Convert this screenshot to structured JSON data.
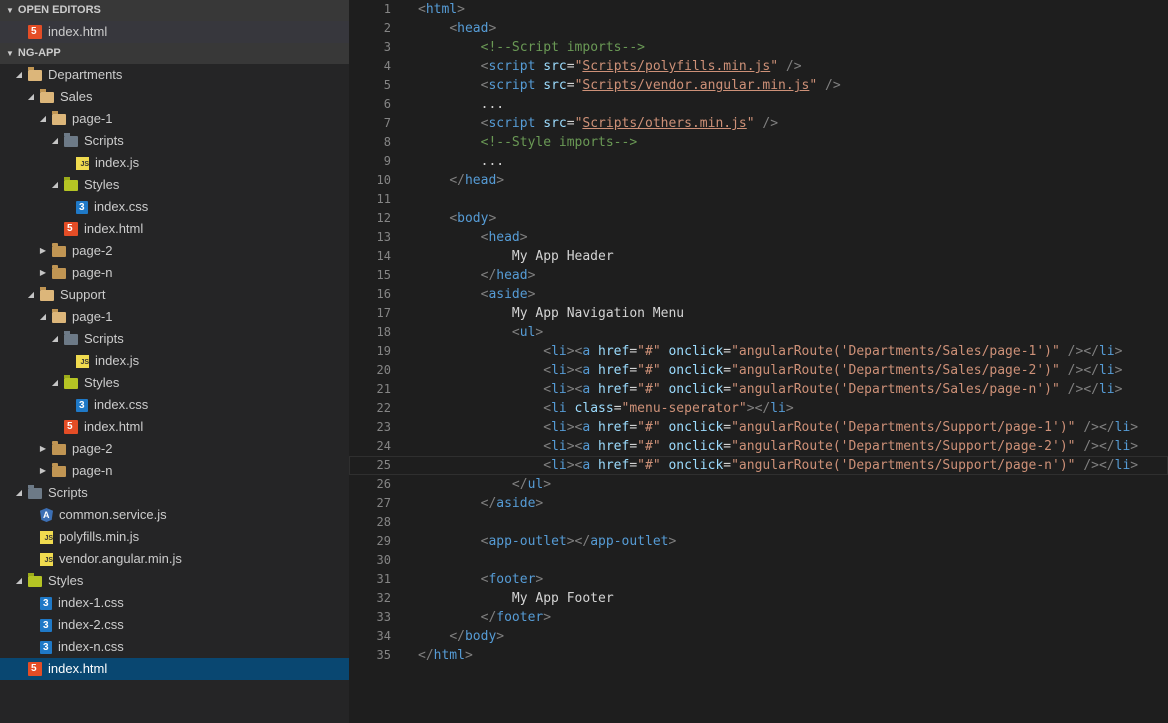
{
  "explorer": {
    "open_editors_title": "OPEN EDITORS",
    "open_editors": [
      {
        "label": "index.html",
        "icon": "html-file-icon"
      }
    ],
    "project_title": "NG-APP",
    "tree": [
      {
        "label": "Departments",
        "depth": 0,
        "expanded": true,
        "icon": "folder-open-icon"
      },
      {
        "label": "Sales",
        "depth": 1,
        "expanded": true,
        "icon": "folder-open-icon"
      },
      {
        "label": "page-1",
        "depth": 2,
        "expanded": true,
        "icon": "folder-open-icon"
      },
      {
        "label": "Scripts",
        "depth": 3,
        "expanded": true,
        "icon": "scripts-folder-icon"
      },
      {
        "label": "index.js",
        "depth": 4,
        "icon": "js-file-icon"
      },
      {
        "label": "Styles",
        "depth": 3,
        "expanded": true,
        "icon": "styles-folder-icon"
      },
      {
        "label": "index.css",
        "depth": 4,
        "icon": "css-file-icon"
      },
      {
        "label": "index.html",
        "depth": 3,
        "icon": "html-file-icon"
      },
      {
        "label": "page-2",
        "depth": 2,
        "expanded": false,
        "icon": "folder-icon"
      },
      {
        "label": "page-n",
        "depth": 2,
        "expanded": false,
        "icon": "folder-icon"
      },
      {
        "label": "Support",
        "depth": 1,
        "expanded": true,
        "icon": "folder-open-icon"
      },
      {
        "label": "page-1",
        "depth": 2,
        "expanded": true,
        "icon": "folder-open-icon"
      },
      {
        "label": "Scripts",
        "depth": 3,
        "expanded": true,
        "icon": "scripts-folder-icon"
      },
      {
        "label": "index.js",
        "depth": 4,
        "icon": "js-file-icon"
      },
      {
        "label": "Styles",
        "depth": 3,
        "expanded": true,
        "icon": "styles-folder-icon"
      },
      {
        "label": "index.css",
        "depth": 4,
        "icon": "css-file-icon"
      },
      {
        "label": "index.html",
        "depth": 3,
        "icon": "html-file-icon"
      },
      {
        "label": "page-2",
        "depth": 2,
        "expanded": false,
        "icon": "folder-icon"
      },
      {
        "label": "page-n",
        "depth": 2,
        "expanded": false,
        "icon": "folder-icon"
      },
      {
        "label": "Scripts",
        "depth": 0,
        "expanded": true,
        "icon": "scripts-folder-icon"
      },
      {
        "label": "common.service.js",
        "depth": 1,
        "icon": "angular-file-icon"
      },
      {
        "label": "polyfills.min.js",
        "depth": 1,
        "icon": "js-file-icon"
      },
      {
        "label": "vendor.angular.min.js",
        "depth": 1,
        "icon": "js-file-icon"
      },
      {
        "label": "Styles",
        "depth": 0,
        "expanded": true,
        "icon": "styles-folder-icon"
      },
      {
        "label": "index-1.css",
        "depth": 1,
        "icon": "css-file-icon"
      },
      {
        "label": "index-2.css",
        "depth": 1,
        "icon": "css-file-icon"
      },
      {
        "label": "index-n.css",
        "depth": 1,
        "icon": "css-file-icon"
      },
      {
        "label": "index.html",
        "depth": 0,
        "icon": "html-file-icon",
        "selected": true
      }
    ]
  },
  "editor": {
    "current_line": 25,
    "lines": [
      [
        [
          "t-br",
          "<"
        ],
        [
          "t-tag",
          "html"
        ],
        [
          "t-br",
          ">"
        ]
      ],
      [
        [
          "t-txt",
          "    "
        ],
        [
          "t-br",
          "<"
        ],
        [
          "t-tag",
          "head"
        ],
        [
          "t-br",
          ">"
        ]
      ],
      [
        [
          "t-txt",
          "        "
        ],
        [
          "t-com",
          "<!--Script imports-->"
        ]
      ],
      [
        [
          "t-txt",
          "        "
        ],
        [
          "t-br",
          "<"
        ],
        [
          "t-tag",
          "script"
        ],
        [
          "t-txt",
          " "
        ],
        [
          "t-attr",
          "src"
        ],
        [
          "t-txt",
          "="
        ],
        [
          "t-str",
          "\""
        ],
        [
          "t-link",
          "Scripts/polyfills.min.js"
        ],
        [
          "t-str",
          "\""
        ],
        [
          "t-txt",
          " "
        ],
        [
          "t-br",
          "/>"
        ]
      ],
      [
        [
          "t-txt",
          "        "
        ],
        [
          "t-br",
          "<"
        ],
        [
          "t-tag",
          "script"
        ],
        [
          "t-txt",
          " "
        ],
        [
          "t-attr",
          "src"
        ],
        [
          "t-txt",
          "="
        ],
        [
          "t-str",
          "\""
        ],
        [
          "t-link",
          "Scripts/vendor.angular.min.js"
        ],
        [
          "t-str",
          "\""
        ],
        [
          "t-txt",
          " "
        ],
        [
          "t-br",
          "/>"
        ]
      ],
      [
        [
          "t-txt",
          "        ..."
        ]
      ],
      [
        [
          "t-txt",
          "        "
        ],
        [
          "t-br",
          "<"
        ],
        [
          "t-tag",
          "script"
        ],
        [
          "t-txt",
          " "
        ],
        [
          "t-attr",
          "src"
        ],
        [
          "t-txt",
          "="
        ],
        [
          "t-str",
          "\""
        ],
        [
          "t-link",
          "Scripts/others.min.js"
        ],
        [
          "t-str",
          "\""
        ],
        [
          "t-txt",
          " "
        ],
        [
          "t-br",
          "/>"
        ]
      ],
      [
        [
          "t-txt",
          "        "
        ],
        [
          "t-com",
          "<!--Style imports-->"
        ]
      ],
      [
        [
          "t-txt",
          "        ..."
        ]
      ],
      [
        [
          "t-txt",
          "    "
        ],
        [
          "t-br",
          "</"
        ],
        [
          "t-tag",
          "head"
        ],
        [
          "t-br",
          ">"
        ]
      ],
      [],
      [
        [
          "t-txt",
          "    "
        ],
        [
          "t-br",
          "<"
        ],
        [
          "t-tag",
          "body"
        ],
        [
          "t-br",
          ">"
        ]
      ],
      [
        [
          "t-txt",
          "        "
        ],
        [
          "t-br",
          "<"
        ],
        [
          "t-tag",
          "head"
        ],
        [
          "t-br",
          ">"
        ]
      ],
      [
        [
          "t-txt",
          "            My App Header"
        ]
      ],
      [
        [
          "t-txt",
          "        "
        ],
        [
          "t-br",
          "</"
        ],
        [
          "t-tag",
          "head"
        ],
        [
          "t-br",
          ">"
        ]
      ],
      [
        [
          "t-txt",
          "        "
        ],
        [
          "t-br",
          "<"
        ],
        [
          "t-tag",
          "aside"
        ],
        [
          "t-br",
          ">"
        ]
      ],
      [
        [
          "t-txt",
          "            My App Navigation Menu"
        ]
      ],
      [
        [
          "t-txt",
          "            "
        ],
        [
          "t-br",
          "<"
        ],
        [
          "t-tag",
          "ul"
        ],
        [
          "t-br",
          ">"
        ]
      ],
      [
        [
          "t-txt",
          "                "
        ],
        [
          "t-br",
          "<"
        ],
        [
          "t-tag",
          "li"
        ],
        [
          "t-br",
          "><"
        ],
        [
          "t-tag",
          "a"
        ],
        [
          "t-txt",
          " "
        ],
        [
          "t-attr",
          "href"
        ],
        [
          "t-txt",
          "="
        ],
        [
          "t-str",
          "\"#\""
        ],
        [
          "t-txt",
          " "
        ],
        [
          "t-attr",
          "onclick"
        ],
        [
          "t-txt",
          "="
        ],
        [
          "t-str",
          "\"angularRoute('Departments/Sales/page-1')\""
        ],
        [
          "t-txt",
          " "
        ],
        [
          "t-br",
          "/></"
        ],
        [
          "t-tag",
          "li"
        ],
        [
          "t-br",
          ">"
        ]
      ],
      [
        [
          "t-txt",
          "                "
        ],
        [
          "t-br",
          "<"
        ],
        [
          "t-tag",
          "li"
        ],
        [
          "t-br",
          "><"
        ],
        [
          "t-tag",
          "a"
        ],
        [
          "t-txt",
          " "
        ],
        [
          "t-attr",
          "href"
        ],
        [
          "t-txt",
          "="
        ],
        [
          "t-str",
          "\"#\""
        ],
        [
          "t-txt",
          " "
        ],
        [
          "t-attr",
          "onclick"
        ],
        [
          "t-txt",
          "="
        ],
        [
          "t-str",
          "\"angularRoute('Departments/Sales/page-2')\""
        ],
        [
          "t-txt",
          " "
        ],
        [
          "t-br",
          "/></"
        ],
        [
          "t-tag",
          "li"
        ],
        [
          "t-br",
          ">"
        ]
      ],
      [
        [
          "t-txt",
          "                "
        ],
        [
          "t-br",
          "<"
        ],
        [
          "t-tag",
          "li"
        ],
        [
          "t-br",
          "><"
        ],
        [
          "t-tag",
          "a"
        ],
        [
          "t-txt",
          " "
        ],
        [
          "t-attr",
          "href"
        ],
        [
          "t-txt",
          "="
        ],
        [
          "t-str",
          "\"#\""
        ],
        [
          "t-txt",
          " "
        ],
        [
          "t-attr",
          "onclick"
        ],
        [
          "t-txt",
          "="
        ],
        [
          "t-str",
          "\"angularRoute('Departments/Sales/page-n')\""
        ],
        [
          "t-txt",
          " "
        ],
        [
          "t-br",
          "/></"
        ],
        [
          "t-tag",
          "li"
        ],
        [
          "t-br",
          ">"
        ]
      ],
      [
        [
          "t-txt",
          "                "
        ],
        [
          "t-br",
          "<"
        ],
        [
          "t-tag",
          "li"
        ],
        [
          "t-txt",
          " "
        ],
        [
          "t-attr",
          "class"
        ],
        [
          "t-txt",
          "="
        ],
        [
          "t-str",
          "\"menu-seperator\""
        ],
        [
          "t-br",
          "></"
        ],
        [
          "t-tag",
          "li"
        ],
        [
          "t-br",
          ">"
        ]
      ],
      [
        [
          "t-txt",
          "                "
        ],
        [
          "t-br",
          "<"
        ],
        [
          "t-tag",
          "li"
        ],
        [
          "t-br",
          "><"
        ],
        [
          "t-tag",
          "a"
        ],
        [
          "t-txt",
          " "
        ],
        [
          "t-attr",
          "href"
        ],
        [
          "t-txt",
          "="
        ],
        [
          "t-str",
          "\"#\""
        ],
        [
          "t-txt",
          " "
        ],
        [
          "t-attr",
          "onclick"
        ],
        [
          "t-txt",
          "="
        ],
        [
          "t-str",
          "\"angularRoute('Departments/Support/page-1')\""
        ],
        [
          "t-txt",
          " "
        ],
        [
          "t-br",
          "/></"
        ],
        [
          "t-tag",
          "li"
        ],
        [
          "t-br",
          ">"
        ]
      ],
      [
        [
          "t-txt",
          "                "
        ],
        [
          "t-br",
          "<"
        ],
        [
          "t-tag",
          "li"
        ],
        [
          "t-br",
          "><"
        ],
        [
          "t-tag",
          "a"
        ],
        [
          "t-txt",
          " "
        ],
        [
          "t-attr",
          "href"
        ],
        [
          "t-txt",
          "="
        ],
        [
          "t-str",
          "\"#\""
        ],
        [
          "t-txt",
          " "
        ],
        [
          "t-attr",
          "onclick"
        ],
        [
          "t-txt",
          "="
        ],
        [
          "t-str",
          "\"angularRoute('Departments/Support/page-2')\""
        ],
        [
          "t-txt",
          " "
        ],
        [
          "t-br",
          "/></"
        ],
        [
          "t-tag",
          "li"
        ],
        [
          "t-br",
          ">"
        ]
      ],
      [
        [
          "t-txt",
          "                "
        ],
        [
          "t-br",
          "<"
        ],
        [
          "t-tag",
          "li"
        ],
        [
          "t-br",
          "><"
        ],
        [
          "t-tag",
          "a"
        ],
        [
          "t-txt",
          " "
        ],
        [
          "t-attr",
          "href"
        ],
        [
          "t-txt",
          "="
        ],
        [
          "t-str",
          "\"#\""
        ],
        [
          "t-txt",
          " "
        ],
        [
          "t-attr",
          "onclick"
        ],
        [
          "t-txt",
          "="
        ],
        [
          "t-str",
          "\"angularRoute('Departments/Support/page-n')\""
        ],
        [
          "t-txt",
          " "
        ],
        [
          "t-br",
          "/></"
        ],
        [
          "t-tag",
          "li"
        ],
        [
          "t-br",
          ">"
        ]
      ],
      [
        [
          "t-txt",
          "            "
        ],
        [
          "t-br",
          "</"
        ],
        [
          "t-tag",
          "ul"
        ],
        [
          "t-br",
          ">"
        ]
      ],
      [
        [
          "t-txt",
          "        "
        ],
        [
          "t-br",
          "</"
        ],
        [
          "t-tag",
          "aside"
        ],
        [
          "t-br",
          ">"
        ]
      ],
      [],
      [
        [
          "t-txt",
          "        "
        ],
        [
          "t-br",
          "<"
        ],
        [
          "t-tag",
          "app-outlet"
        ],
        [
          "t-br",
          "></"
        ],
        [
          "t-tag",
          "app-outlet"
        ],
        [
          "t-br",
          ">"
        ]
      ],
      [],
      [
        [
          "t-txt",
          "        "
        ],
        [
          "t-br",
          "<"
        ],
        [
          "t-tag",
          "footer"
        ],
        [
          "t-br",
          ">"
        ]
      ],
      [
        [
          "t-txt",
          "            My App Footer"
        ]
      ],
      [
        [
          "t-txt",
          "        "
        ],
        [
          "t-br",
          "</"
        ],
        [
          "t-tag",
          "footer"
        ],
        [
          "t-br",
          ">"
        ]
      ],
      [
        [
          "t-txt",
          "    "
        ],
        [
          "t-br",
          "</"
        ],
        [
          "t-tag",
          "body"
        ],
        [
          "t-br",
          ">"
        ]
      ],
      [
        [
          "t-br",
          "</"
        ],
        [
          "t-tag",
          "html"
        ],
        [
          "t-br",
          ">"
        ]
      ]
    ]
  }
}
